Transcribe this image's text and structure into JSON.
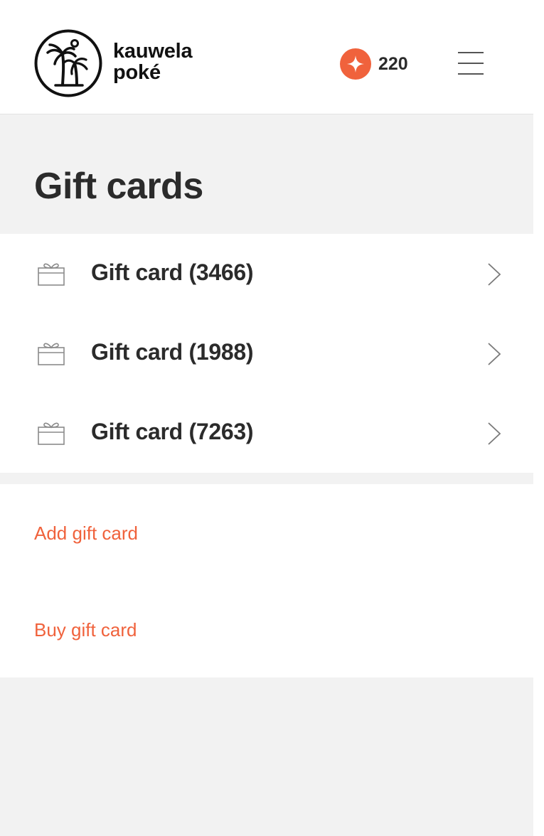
{
  "header": {
    "brand_line1": "kauwela",
    "brand_line2": "poké",
    "points": "220",
    "logo_icon": "palm-trees-logo",
    "points_icon": "sparkle-icon",
    "menu_icon": "hamburger-menu-icon"
  },
  "page": {
    "title": "Gift cards"
  },
  "gift_cards": [
    {
      "label": "Gift card (3466)"
    },
    {
      "label": "Gift card (1988)"
    },
    {
      "label": "Gift card (7263)"
    }
  ],
  "actions": {
    "add_label": "Add gift card",
    "buy_label": "Buy gift card"
  },
  "colors": {
    "accent": "#f0623c",
    "text": "#2b2b2b",
    "background": "#f2f2f2"
  }
}
